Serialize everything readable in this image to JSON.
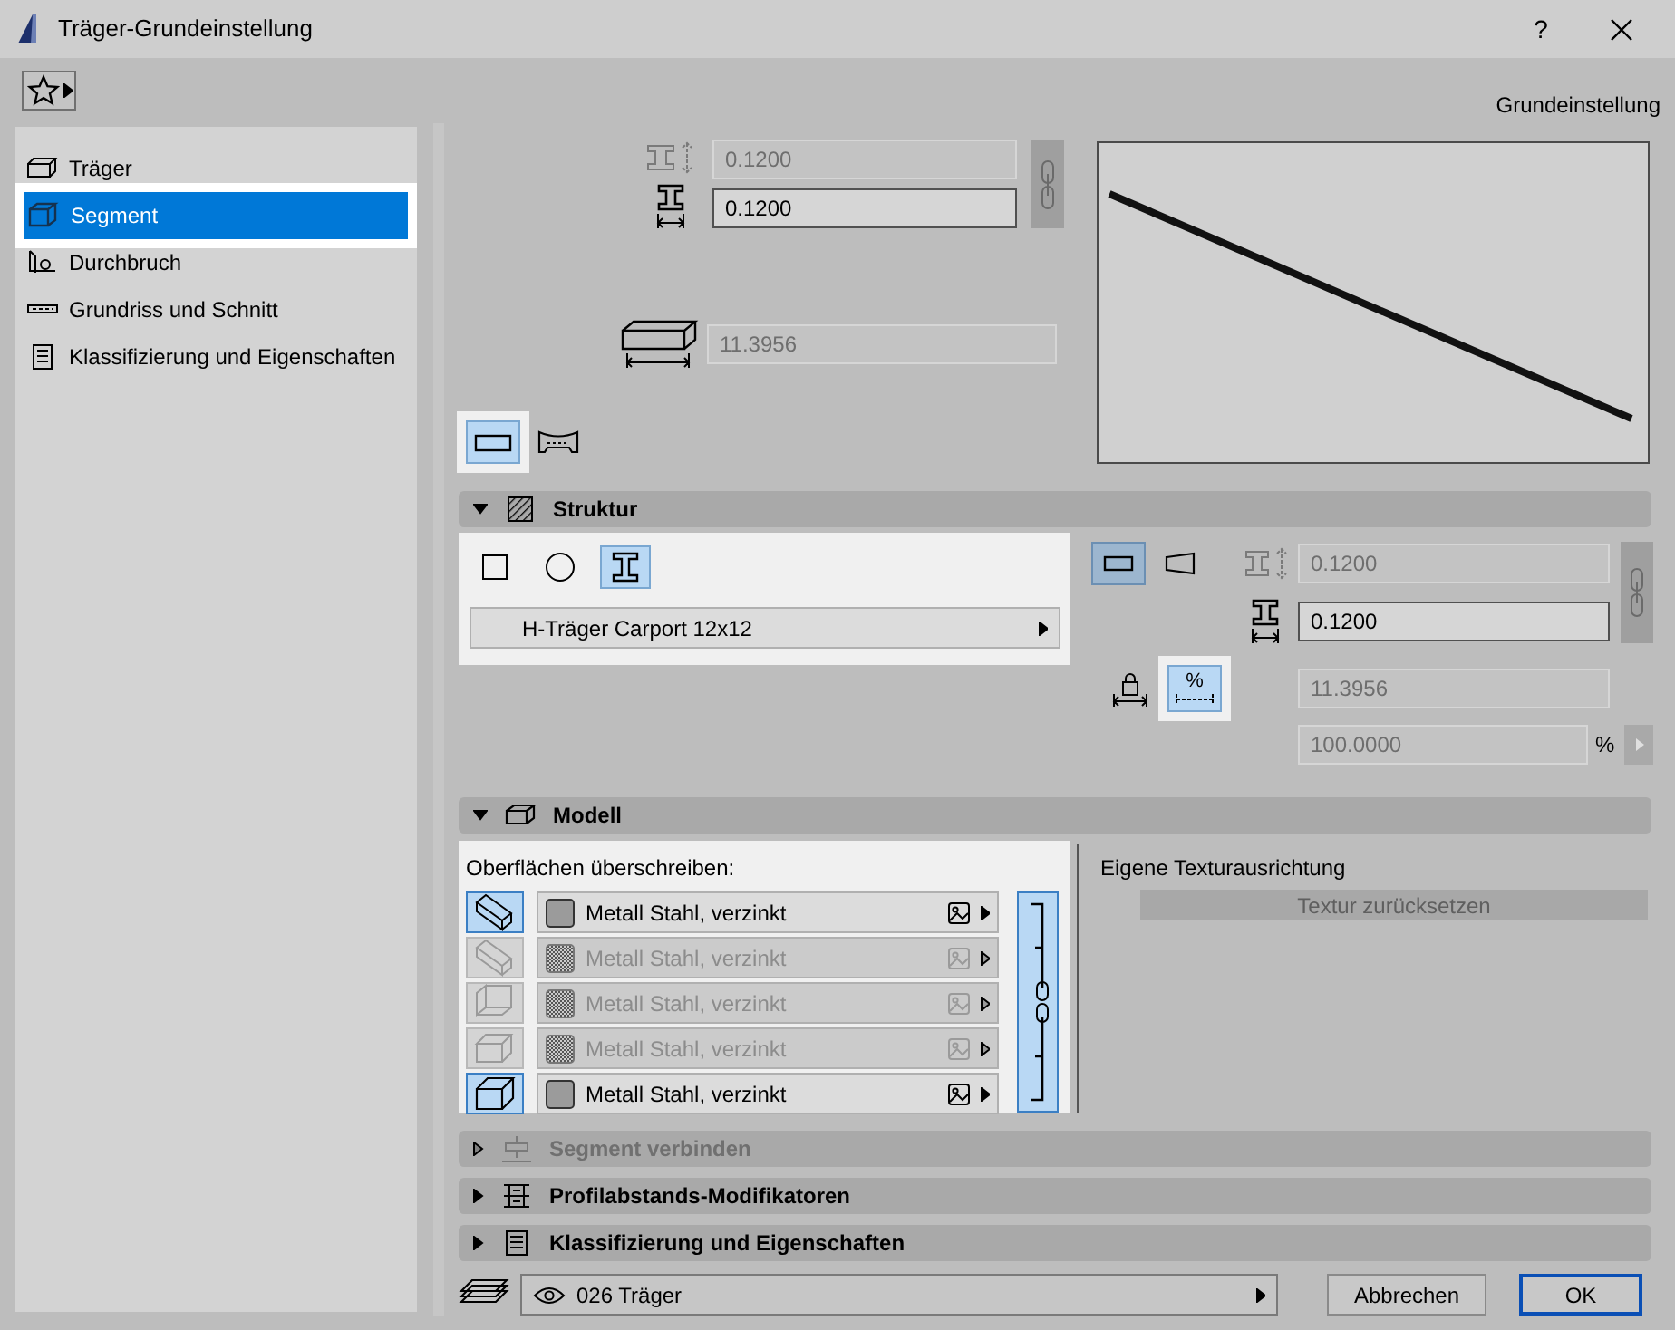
{
  "window": {
    "title": "Träger-Grundeinstellung",
    "help": "?"
  },
  "toolbar": {
    "preset": "Grundeinstellung"
  },
  "sidebar": {
    "items": [
      {
        "kind": "beam",
        "label": "Träger",
        "selected": false
      },
      {
        "kind": "segment",
        "label": "Segment",
        "selected": true
      },
      {
        "kind": "opening",
        "label": "Durchbruch",
        "selected": false
      },
      {
        "kind": "plan",
        "label": "Grundriss und Schnitt",
        "selected": false
      },
      {
        "kind": "properties",
        "label": "Klassifizierung und Eigenschaften",
        "selected": false
      }
    ]
  },
  "geometry": {
    "height": {
      "value": "0.1200",
      "disabled": true
    },
    "width": {
      "value": "0.1200",
      "disabled": false
    },
    "length": {
      "value": "11.3956",
      "disabled": true
    },
    "shapes": [
      {
        "kind": "straight",
        "selected": true
      },
      {
        "kind": "curved",
        "selected": false
      }
    ]
  },
  "struktur": {
    "title": "Struktur",
    "expanded": true,
    "profile_types": [
      {
        "kind": "rectangle",
        "selected": false
      },
      {
        "kind": "circle",
        "selected": false
      },
      {
        "kind": "profile",
        "selected": true
      }
    ],
    "profile": "H-Träger Carport 12x12",
    "segment_shapes": [
      {
        "kind": "straight",
        "selected": true
      },
      {
        "kind": "tapered",
        "selected": false
      }
    ],
    "height": {
      "value": "0.1200",
      "disabled": true
    },
    "width": {
      "value": "0.1200",
      "disabled": false
    },
    "length_modes": [
      {
        "kind": "lock",
        "selected": false
      },
      {
        "kind": "percent",
        "label": "%",
        "selected": true
      }
    ],
    "length": {
      "value": "11.3956",
      "disabled": true
    },
    "percent": {
      "value": "100.0000",
      "unit": "%",
      "disabled": true
    }
  },
  "modell": {
    "title": "Modell",
    "expanded": true,
    "override_label": "Oberflächen überschreiben:",
    "surfaces": [
      {
        "kind": "end",
        "on": true,
        "material": "Metall Stahl, verzinkt"
      },
      {
        "kind": "top",
        "on": false,
        "material": "Metall Stahl, verzinkt"
      },
      {
        "kind": "side",
        "on": false,
        "material": "Metall Stahl, verzinkt"
      },
      {
        "kind": "bottom",
        "on": false,
        "material": "Metall Stahl, verzinkt"
      },
      {
        "kind": "start",
        "on": true,
        "material": "Metall Stahl, verzinkt"
      }
    ],
    "texture_label": "Eigene Texturausrichtung",
    "reset_button": "Textur zurücksetzen"
  },
  "collapsed_panels": [
    {
      "kind": "connect",
      "title": "Segment verbinden",
      "disabled": true
    },
    {
      "kind": "modifiers",
      "title": "Profilabstands-Modifikatoren",
      "disabled": false
    },
    {
      "kind": "properties",
      "title": "Klassifizierung und Eigenschaften",
      "disabled": false
    }
  ],
  "footer": {
    "layer": "026 Träger",
    "cancel": "Abbrechen",
    "ok": "OK"
  }
}
